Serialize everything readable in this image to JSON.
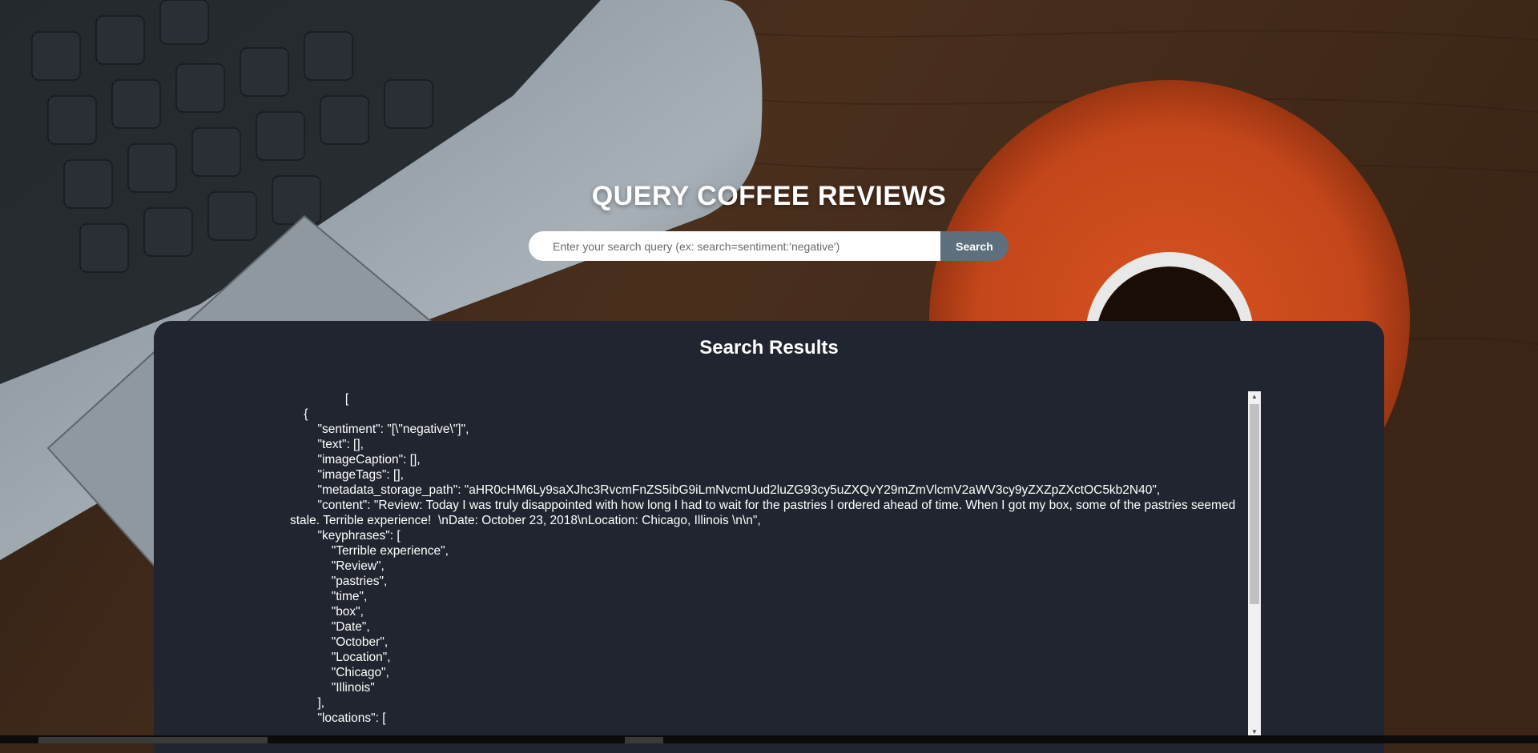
{
  "hero": {
    "title": "QUERY COFFEE REVIEWS"
  },
  "search": {
    "placeholder": "Enter your search query (ex: search=sentiment:'negative')",
    "value": "",
    "button_label": "Search"
  },
  "results": {
    "title": "Search Results",
    "json_text": "                [\n    {\n        \"sentiment\": \"[\\\"negative\\\"]\",\n        \"text\": [],\n        \"imageCaption\": [],\n        \"imageTags\": [],\n        \"metadata_storage_path\": \"aHR0cHM6Ly9saXJhc3RvcmFnZS5ibG9iLmNvcmUud2luZG93cy5uZXQvY29mZmVlcmV2aWV3cy9yZXZpZXctOC5kb2N40\",\n        \"content\": \"Review: Today I was truly disappointed with how long I had to wait for the pastries I ordered ahead of time. When I got my box, some of the pastries seemed stale. Terrible experience!  \\nDate: October 23, 2018\\nLocation: Chicago, Illinois \\n\\n\",\n        \"keyphrases\": [\n            \"Terrible experience\",\n            \"Review\",\n            \"pastries\",\n            \"time\",\n            \"box\",\n            \"Date\",\n            \"October\",\n            \"Location\",\n            \"Chicago\",\n            \"Illinois\"\n        ],\n        \"locations\": ["
  },
  "icons": {
    "scroll_up": "scroll-up-arrow-icon",
    "scroll_down": "scroll-down-arrow-icon"
  },
  "colors": {
    "panel_bg": "#21252f",
    "button_bg": "#5e6f7e",
    "text": "#ffffff"
  }
}
